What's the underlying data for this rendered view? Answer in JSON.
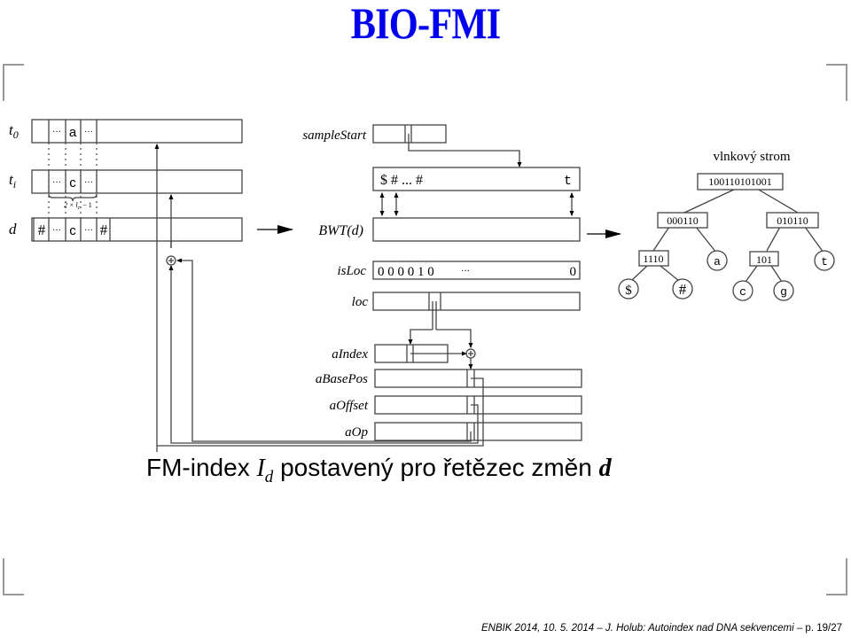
{
  "slide": {
    "title": "BIO-FMI",
    "title_color": "#0000ee",
    "caption": {
      "prefix": "FM-index ",
      "index_symbol": "I",
      "index_subscript": "d",
      "middle": " postavený pro řetězec změn ",
      "string_symbol": "d"
    },
    "footer": {
      "text": "ENBIK 2014, 10. 5. 2014 – J. Holub: Autoindex nad DNA sekvencemi – ",
      "page": "p. 19/27"
    }
  },
  "strings": {
    "t0": {
      "label": "t",
      "subscript": "0",
      "cells": [
        "",
        "···",
        "a",
        "···"
      ]
    },
    "ti": {
      "label": "t",
      "subscript": "i",
      "cells": [
        "",
        "···",
        "c",
        "···"
      ]
    },
    "d": {
      "label": "d",
      "cells": [
        "#",
        "···",
        "c",
        "···",
        "#"
      ]
    },
    "brace_label": "2 × l",
    "brace_sub": "c",
    "brace_suffix": "− 1"
  },
  "structures": {
    "sampleStart": "sampleStart",
    "bwt_label": "BWT(d)",
    "bwt_top_content": {
      "left": "$ # ... #",
      "right": "t"
    },
    "isLoc": {
      "label": "isLoc",
      "bits": "0 0 0 0 1 0",
      "ellipsis": "···",
      "last": "0"
    },
    "loc": "loc",
    "aIndex": "aIndex",
    "aBasePos": "aBasePos",
    "aOffset": "aOffset",
    "aOp": "aOp"
  },
  "wavelet_tree": {
    "title": "vlnkový strom",
    "root": "100110101001",
    "left": "000110",
    "right": "010110",
    "left_left": "1110",
    "right_left": "101",
    "leaves": {
      "dollar": "$",
      "hash": "#",
      "a": "a",
      "c": "c",
      "g": "g",
      "t": "t"
    }
  }
}
